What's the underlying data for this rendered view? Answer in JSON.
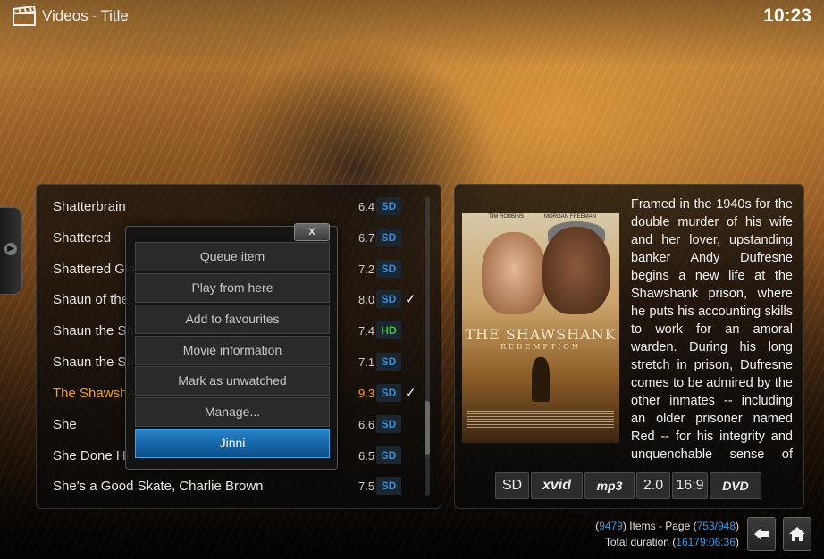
{
  "header": {
    "section": "Videos",
    "view": "Title",
    "clock": "10:23"
  },
  "list": {
    "items": [
      {
        "name": "Shatterbrain",
        "rating": "6.4",
        "quality": "SD",
        "watched": false
      },
      {
        "name": "Shattered",
        "rating": "6.7",
        "quality": "SD",
        "watched": false
      },
      {
        "name": "Shattered Gla",
        "rating": "7.2",
        "quality": "SD",
        "watched": false
      },
      {
        "name": "Shaun of the",
        "rating": "8.0",
        "quality": "SD",
        "watched": true
      },
      {
        "name": "Shaun the Sh",
        "rating": "7.4",
        "quality": "HD",
        "watched": false
      },
      {
        "name": "Shaun the Sh",
        "rating": "7.1",
        "quality": "SD",
        "watched": false
      },
      {
        "name": "The Shawsha",
        "rating": "9.3",
        "quality": "SD",
        "watched": true
      },
      {
        "name": "She",
        "rating": "6.6",
        "quality": "SD",
        "watched": false
      },
      {
        "name": "She Done Hi",
        "rating": "6.5",
        "quality": "SD",
        "watched": false
      },
      {
        "name": "She's a Good Skate, Charlie Brown",
        "rating": "7.5",
        "quality": "SD",
        "watched": false
      }
    ],
    "check_glyph": "✓"
  },
  "context_menu": {
    "close_label": "x",
    "items": [
      "Queue item",
      "Play from here",
      "Add to favourites",
      "Movie information",
      "Mark as unwatched",
      "Manage...",
      "Jinni"
    ],
    "active_index": 6
  },
  "info": {
    "poster": {
      "actor_left": "TIM ROBBINS",
      "actor_right": "MORGAN FREEMAN",
      "title": "THE SHAWSHANK",
      "subtitle": "REDEMPTION"
    },
    "plot": "Framed in the 1940s for the double murder of his wife and her lover, upstanding banker Andy Dufresne begins a new life at the Shawshank prison, where he puts his accounting skills to work for an amoral warden. During his long stretch in prison, Dufresne comes to be admired by the other inmates -- including an older prisoner named Red -- for his integrity and unquenchable sense of hope.",
    "flags": [
      "SD",
      "xvid",
      "mp3",
      "2.0",
      "16:9",
      "DVD"
    ]
  },
  "footer": {
    "items_count": "9479",
    "items_label": "Items - Page",
    "page": "753/948",
    "duration_label": "Total duration",
    "duration": "16179:06:36"
  },
  "colors": {
    "accent_blue": "#3a9ae8",
    "highlight_orange": "#f0a030",
    "hd_green": "#39c43c"
  }
}
